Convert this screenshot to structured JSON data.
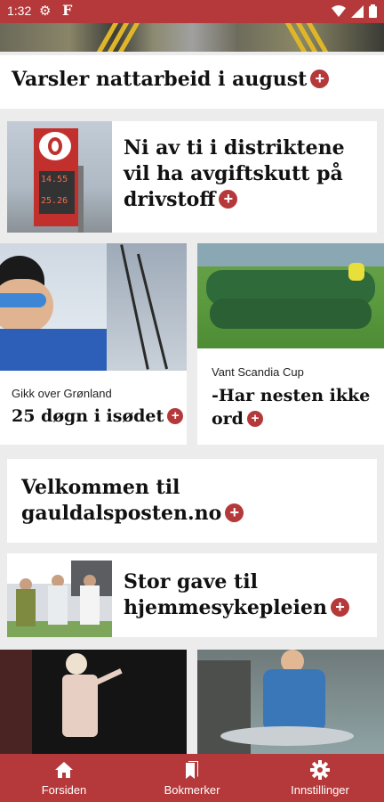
{
  "status_bar": {
    "time": "1:32",
    "app_glyph": "F",
    "icons": [
      "settings-icon",
      "wifi-icon",
      "signal-icon",
      "battery-icon"
    ]
  },
  "articles": [
    {
      "headline": "Varsler nattarbeid i august"
    },
    {
      "headline": "Ni av ti i distriktene vil ha avgiftskutt på drivstoff",
      "sign_price_1": "14.55",
      "sign_price_2": "25.26"
    },
    {
      "kicker": "Gikk over Grønland",
      "headline": "25 døgn i isødet"
    },
    {
      "kicker": "Vant Scandia Cup",
      "headline": "-Har nesten ikke ord"
    },
    {
      "headline": "Velkommen til gauldalsposten.no"
    },
    {
      "headline": "Stor gave til hjemmesykepleien"
    }
  ],
  "bottom_nav": [
    {
      "label": "Forsiden",
      "icon": "home-icon"
    },
    {
      "label": "Bokmerker",
      "icon": "bookmarks-icon"
    },
    {
      "label": "Innstillinger",
      "icon": "settings-icon"
    }
  ],
  "colors": {
    "brand": "#b5393a",
    "background": "#ececec",
    "card": "#ffffff"
  }
}
